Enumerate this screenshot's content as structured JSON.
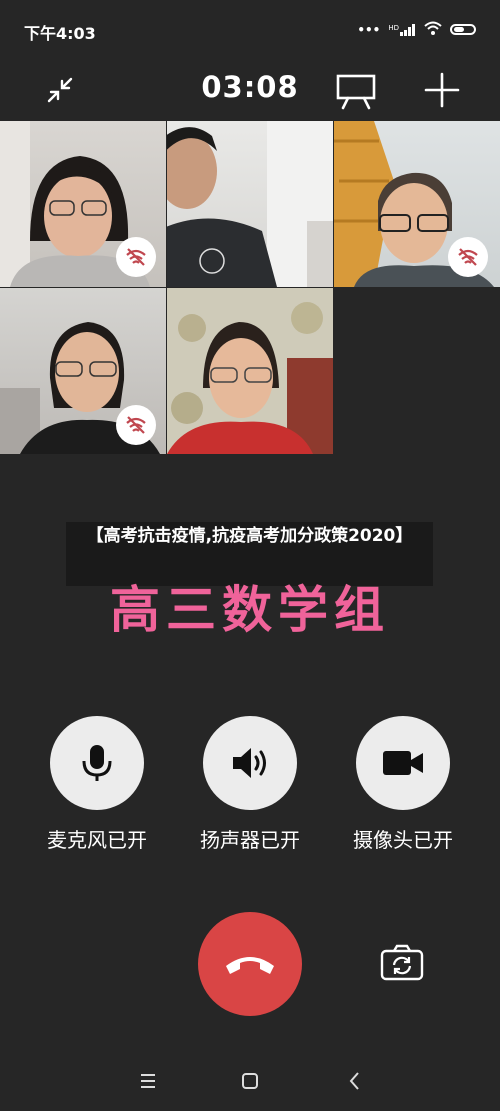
{
  "status": {
    "time": "下午4:03",
    "hd": "HD"
  },
  "call": {
    "timer": "03:08"
  },
  "icons": {
    "minimize": "collapse-arrows-icon",
    "whiteboard": "presentation-board-icon",
    "add": "plus-icon",
    "mic": "microphone-icon",
    "speaker": "speaker-icon",
    "camera": "video-camera-icon",
    "hangup": "phone-hangup-icon",
    "flip": "camera-switch-icon",
    "muted": "mic-muted-icon"
  },
  "participants": [
    {
      "name": "participant-1",
      "muted": true
    },
    {
      "name": "participant-2",
      "muted": false
    },
    {
      "name": "participant-3",
      "muted": true
    },
    {
      "name": "participant-4",
      "muted": true
    },
    {
      "name": "participant-5",
      "muted": false
    }
  ],
  "caption": {
    "text": "【高考抗击疫情,抗疫高考加分政策2020】"
  },
  "group": {
    "name": "高三数学组"
  },
  "controls": {
    "mic_label": "麦克风已开",
    "speaker_label": "扬声器已开",
    "camera_label": "摄像头已开"
  },
  "colors": {
    "background": "#262626",
    "hangup": "#d94545",
    "group_name": "#f0639a",
    "control_circle": "#ececec",
    "muted_icon": "#c0474f"
  }
}
